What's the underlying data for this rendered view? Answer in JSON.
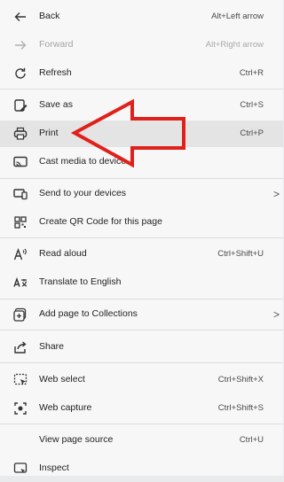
{
  "menu": {
    "items": [
      {
        "name": "back",
        "icon": "back-arrow-icon",
        "label": "Back",
        "shortcut": "Alt+Left arrow",
        "disabled": false
      },
      {
        "name": "forward",
        "icon": "forward-arrow-icon",
        "label": "Forward",
        "shortcut": "Alt+Right arrow",
        "disabled": true
      },
      {
        "name": "refresh",
        "icon": "refresh-icon",
        "label": "Refresh",
        "shortcut": "Ctrl+R",
        "disabled": false
      },
      {
        "name": "save-as",
        "icon": "save-as-icon",
        "label": "Save as",
        "shortcut": "Ctrl+S",
        "disabled": false
      },
      {
        "name": "print",
        "icon": "printer-icon",
        "label": "Print",
        "shortcut": "Ctrl+P",
        "disabled": false
      },
      {
        "name": "cast",
        "icon": "cast-icon",
        "label": "Cast media to device",
        "shortcut": "",
        "disabled": false
      },
      {
        "name": "send-to-devices",
        "icon": "send-to-devices-icon",
        "label": "Send to your devices",
        "shortcut": "",
        "disabled": false,
        "submenu": true
      },
      {
        "name": "qr-code",
        "icon": "qr-code-icon",
        "label": "Create QR Code for this page",
        "shortcut": "",
        "disabled": false
      },
      {
        "name": "read-aloud",
        "icon": "read-aloud-icon",
        "label": "Read aloud",
        "shortcut": "Ctrl+Shift+U",
        "disabled": false
      },
      {
        "name": "translate",
        "icon": "translate-icon",
        "label": "Translate to English",
        "shortcut": "",
        "disabled": false
      },
      {
        "name": "collections",
        "icon": "collections-icon",
        "label": "Add page to Collections",
        "shortcut": "",
        "disabled": false,
        "submenu": true
      },
      {
        "name": "share",
        "icon": "share-icon",
        "label": "Share",
        "shortcut": "",
        "disabled": false
      },
      {
        "name": "web-select",
        "icon": "web-select-icon",
        "label": "Web select",
        "shortcut": "Ctrl+Shift+X",
        "disabled": false
      },
      {
        "name": "web-capture",
        "icon": "web-capture-icon",
        "label": "Web capture",
        "shortcut": "Ctrl+Shift+S",
        "disabled": false
      },
      {
        "name": "view-source",
        "icon": "",
        "label": "View page source",
        "shortcut": "Ctrl+U",
        "disabled": false
      },
      {
        "name": "inspect",
        "icon": "inspect-icon",
        "label": "Inspect",
        "shortcut": "",
        "disabled": false
      }
    ],
    "submenu_glyph": ">"
  },
  "annotation": {
    "icon": "red-arrow-icon",
    "color": "#e0201a"
  }
}
